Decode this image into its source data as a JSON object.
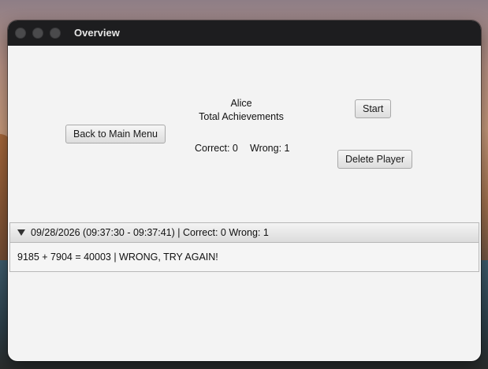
{
  "window": {
    "title": "Overview"
  },
  "buttons": {
    "back": "Back to Main Menu",
    "start": "Start",
    "delete": "Delete Player"
  },
  "player": {
    "name": "Alice",
    "total_achievements_label": "Total Achievements",
    "correct_label": "Correct: 0",
    "wrong_label": "Wrong: 1"
  },
  "sessions": [
    {
      "header": "09/28/2026 (09:37:30 - 09:37:41) | Correct: 0  Wrong: 1",
      "expanded": true,
      "entries": [
        "9185 + 7904 = 40003 | WRONG, TRY AGAIN!"
      ]
    }
  ],
  "icons": {
    "expand": "disclosure-arrow-down-icon"
  }
}
